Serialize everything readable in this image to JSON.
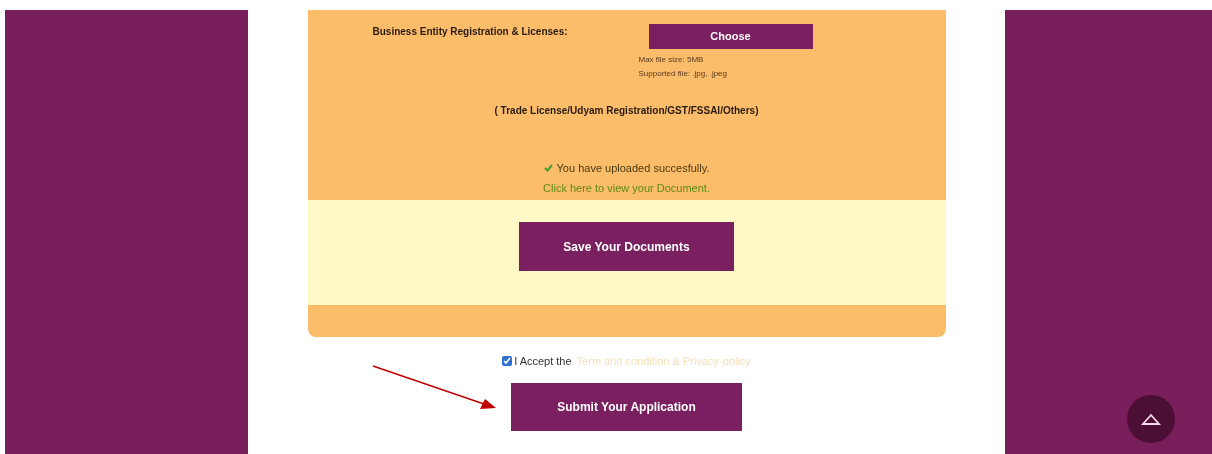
{
  "upload": {
    "label": "Business Entity Registration & Licenses:",
    "button": "Choose",
    "notes": [
      "Max file size: 5MB",
      "Supported file: .jpg, .jpeg"
    ],
    "types": "( Trade License/Udyam Registration/GST/FSSAI/Others)",
    "success": "You have uploaded succesfully.",
    "view_link": "Click here to view your Document."
  },
  "save_button": "Save Your Documents",
  "terms": {
    "checked": true,
    "text": "I Accept the",
    "link": "Term and condition & Privacy-policy"
  },
  "submit_button": "Submit Your Application"
}
